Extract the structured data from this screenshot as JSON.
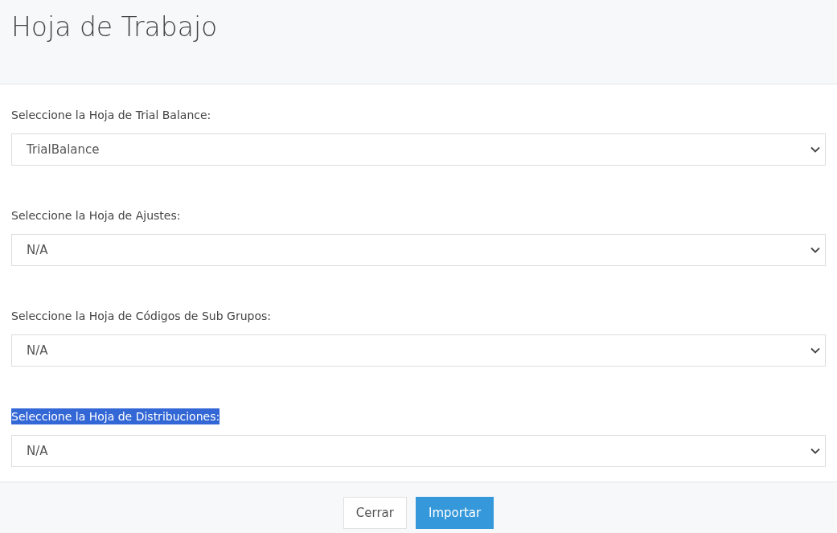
{
  "title": "Hoja de Trabajo",
  "fields": [
    {
      "label": "Seleccione la Hoja de Trial Balance:",
      "value": "TrialBalance",
      "highlighted": false
    },
    {
      "label": "Seleccione la Hoja de Ajustes:",
      "value": "N/A",
      "highlighted": false
    },
    {
      "label": "Seleccione la Hoja de Códigos de Sub Grupos:",
      "value": "N/A",
      "highlighted": false
    },
    {
      "label": "Seleccione la Hoja de Distribuciones:",
      "value": "N/A",
      "highlighted": true
    }
  ],
  "buttons": [
    {
      "label": "Cerrar",
      "kind": "secondary"
    },
    {
      "label": "Importar",
      "kind": "primary"
    }
  ]
}
